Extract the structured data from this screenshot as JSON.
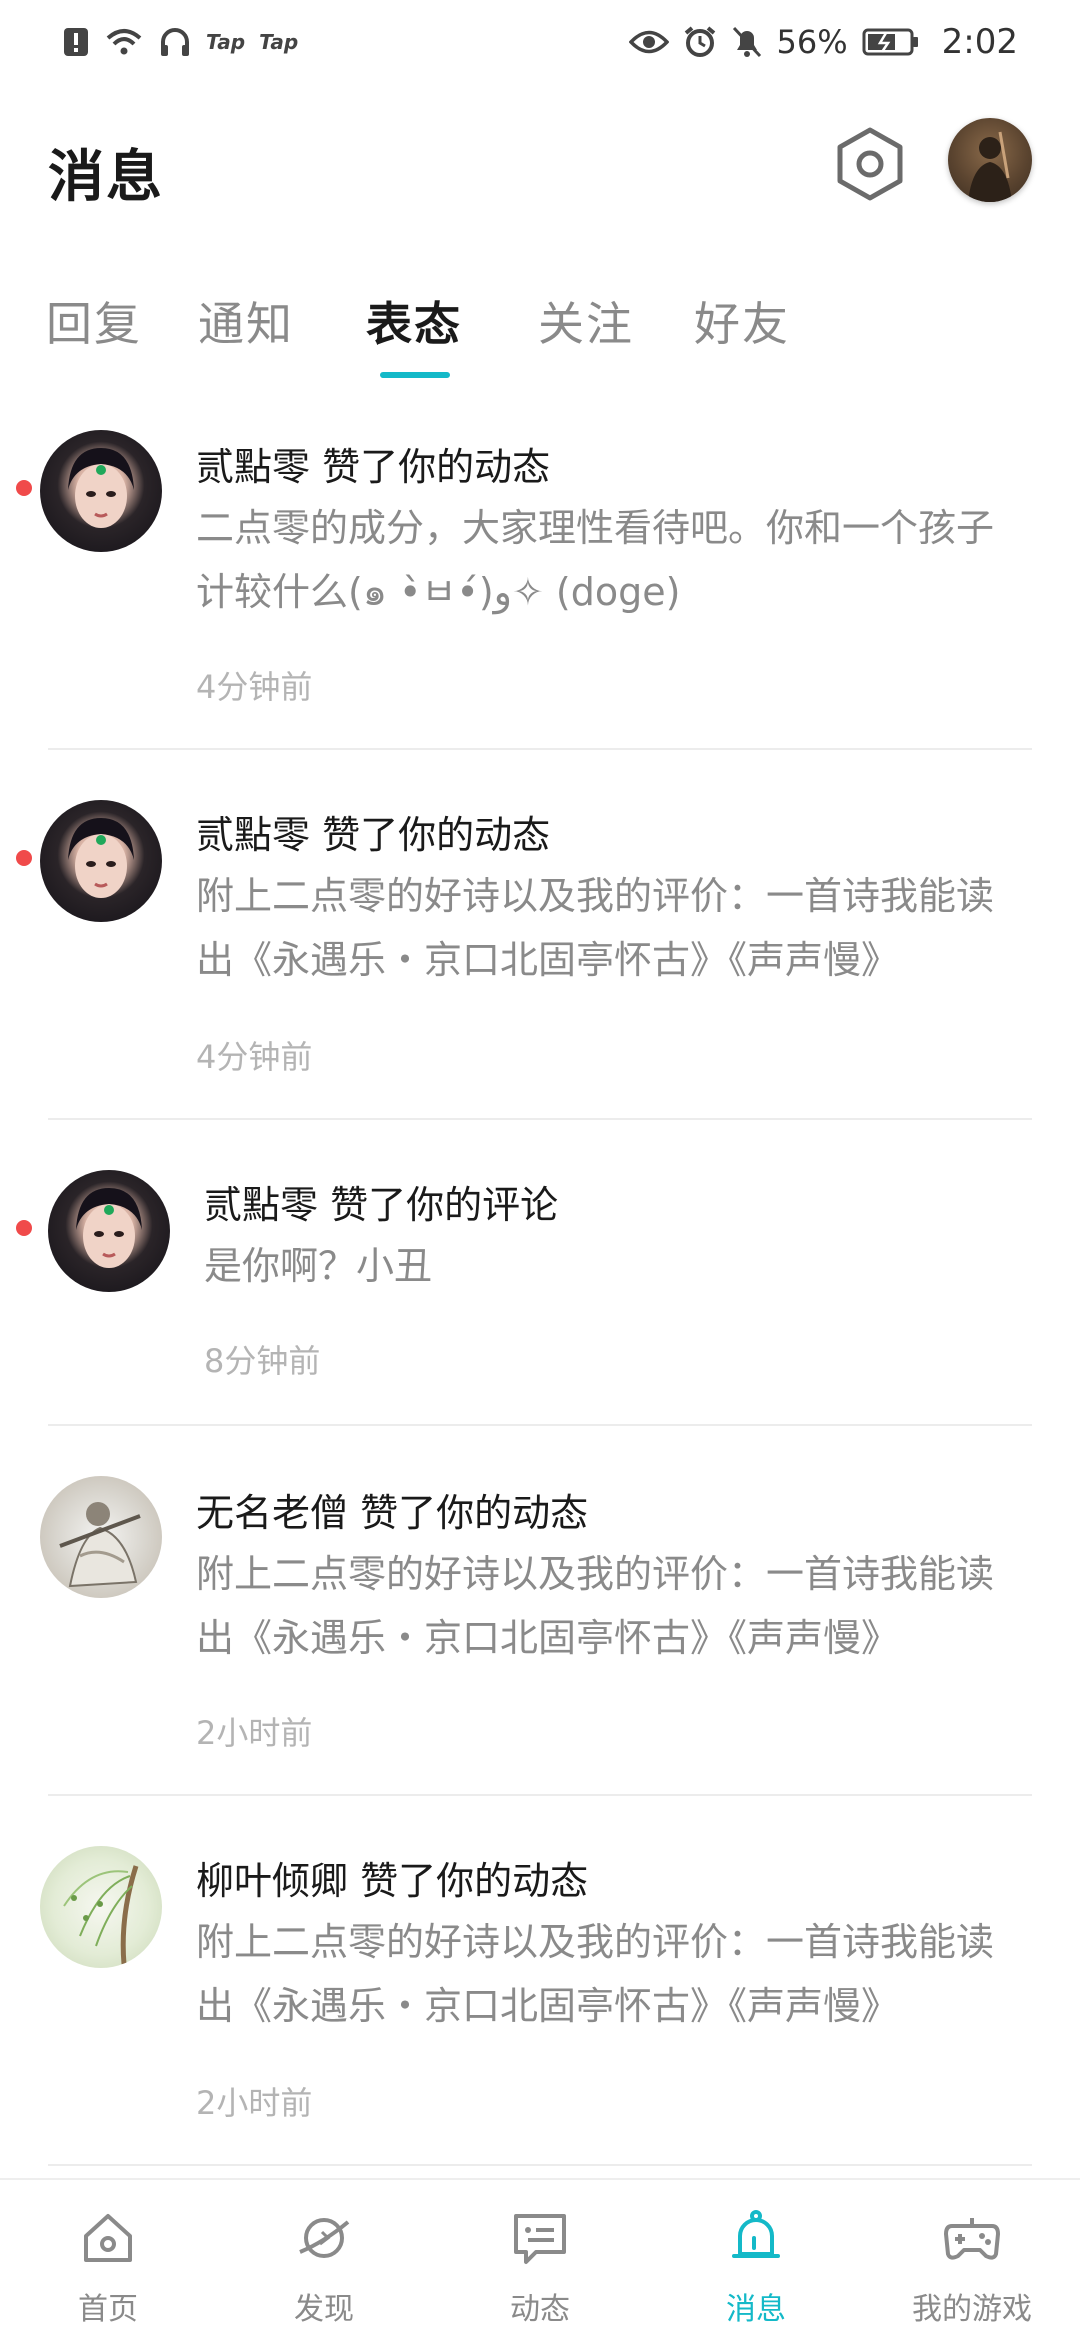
{
  "status_bar": {
    "app_badges": [
      "Tap",
      "Tap"
    ],
    "battery": "56%",
    "time": "2:02"
  },
  "header": {
    "title": "消息",
    "settings_icon": "settings-hex-icon"
  },
  "tabs": [
    {
      "label": "回复"
    },
    {
      "label": "通知"
    },
    {
      "label": "表态",
      "active": true
    },
    {
      "label": "关注"
    },
    {
      "label": "好友"
    }
  ],
  "messages": [
    {
      "title": "贰點零 赞了你的动态",
      "body": "二点零的成分，大家理性看待吧。你和一个孩子计较什么(๑ •̀ㅂ•́)و✧ (doge)",
      "time": "4分钟前",
      "unread": true
    },
    {
      "title": "贰點零 赞了你的动态",
      "body": "附上二点零的好诗以及我的评价：一首诗我能读出《永遇乐・京口北固亭怀古》《声声慢》",
      "time": "4分钟前",
      "unread": true
    },
    {
      "title": "贰點零 赞了你的评论",
      "body": "是你啊？小丑",
      "time": "8分钟前",
      "unread": true
    },
    {
      "title": "无名老僧 赞了你的动态",
      "body": "附上二点零的好诗以及我的评价：一首诗我能读出《永遇乐・京口北固亭怀古》《声声慢》",
      "time": "2小时前",
      "unread": false
    },
    {
      "title": "柳叶倾卿 赞了你的动态",
      "body": "附上二点零的好诗以及我的评价：一首诗我能读出《永遇乐・京口北固亭怀古》《声声慢》",
      "time": "2小时前",
      "unread": false
    }
  ],
  "bottom_nav": [
    {
      "label": "首页",
      "icon": "home-icon"
    },
    {
      "label": "发现",
      "icon": "discover-planet-icon"
    },
    {
      "label": "动态",
      "icon": "feed-chat-icon"
    },
    {
      "label": "消息",
      "icon": "bell-icon",
      "active": true
    },
    {
      "label": "我的游戏",
      "icon": "gamepad-icon"
    }
  ],
  "colors": {
    "accent": "#14b9c8",
    "unread_dot": "#f04a4a",
    "muted_text": "#8a8a8a"
  }
}
